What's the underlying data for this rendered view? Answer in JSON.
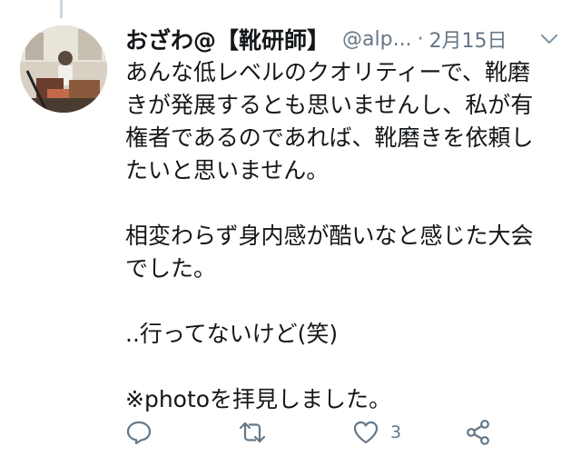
{
  "tweet": {
    "display_name": "おざわ@【靴研師】",
    "handle": "@alp...",
    "separator": "·",
    "date": "2月15日",
    "body_lines": [
      "あんな低レベルのクオリティーで、靴磨",
      "きが発展するとも思いませんし、私が有",
      "権者であるのであれば、靴磨きを依頼し",
      "たいと思いません。",
      "",
      "相変わらず身内感が酷いなと感じた大会",
      "でした。",
      "",
      "..行ってないけど(笑)",
      "",
      "※photoを拝見しました。"
    ],
    "actions": {
      "reply_icon": "reply-icon",
      "retweet_icon": "retweet-icon",
      "like_icon": "heart-icon",
      "like_count": "3",
      "share_icon": "share-icon"
    },
    "colors": {
      "text": "#14171a",
      "secondary": "#657786",
      "thread_line": "#ccd6dd"
    }
  }
}
